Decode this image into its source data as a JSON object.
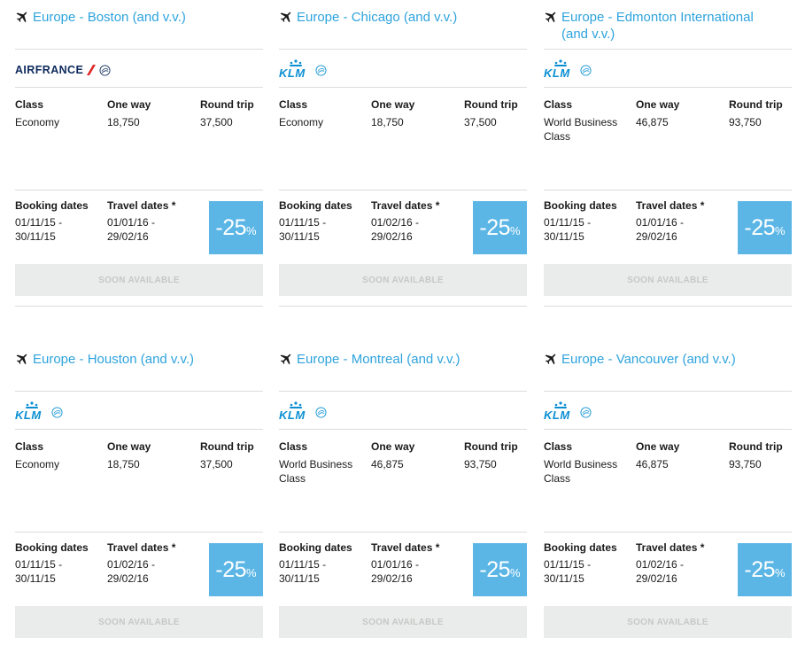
{
  "labels": {
    "class": "Class",
    "one_way": "One way",
    "round_trip": "Round trip",
    "booking_dates": "Booking dates",
    "travel_dates": "Travel dates *",
    "soon_available": "SOON AVAILABLE",
    "discount_number": "-25",
    "discount_percent": "%"
  },
  "colors": {
    "link_blue": "#2ea3dd",
    "discount_bg": "#5bb6e6",
    "klm_blue": "#0a8fd3",
    "airfrance_navy": "#0d2a5c",
    "airfrance_red": "#e02a2a",
    "button_bg": "#eaeceb"
  },
  "offers": [
    {
      "route": "Europe - Boston (and v.v.)",
      "airline": "AIRFRANCE",
      "class_value": "Economy",
      "one_way": "18,750",
      "round_trip": "37,500",
      "booking": "01/11/15 - 30/11/15",
      "travel": "01/01/16 - 29/02/16"
    },
    {
      "route": "Europe - Chicago (and v.v.)",
      "airline": "KLM",
      "class_value": "Economy",
      "one_way": "18,750",
      "round_trip": "37,500",
      "booking": "01/11/15 - 30/11/15",
      "travel": "01/02/16 - 29/02/16"
    },
    {
      "route": "Europe - Edmonton International (and v.v.)",
      "airline": "KLM",
      "class_value": "World Business Class",
      "one_way": "46,875",
      "round_trip": "93,750",
      "booking": "01/11/15 - 30/11/15",
      "travel": "01/01/16 - 29/02/16"
    },
    {
      "route": "Europe - Houston (and v.v.)",
      "airline": "KLM",
      "class_value": "Economy",
      "one_way": "18,750",
      "round_trip": "37,500",
      "booking": "01/11/15 - 30/11/15",
      "travel": "01/02/16 - 29/02/16"
    },
    {
      "route": "Europe - Montreal (and v.v.)",
      "airline": "KLM",
      "class_value": "World Business Class",
      "one_way": "46,875",
      "round_trip": "93,750",
      "booking": "01/11/15 - 30/11/15",
      "travel": "01/01/16 - 29/02/16"
    },
    {
      "route": "Europe - Vancouver (and v.v.)",
      "airline": "KLM",
      "class_value": "World Business Class",
      "one_way": "46,875",
      "round_trip": "93,750",
      "booking": "01/11/15 - 30/11/15",
      "travel": "01/02/16 - 29/02/16"
    }
  ]
}
